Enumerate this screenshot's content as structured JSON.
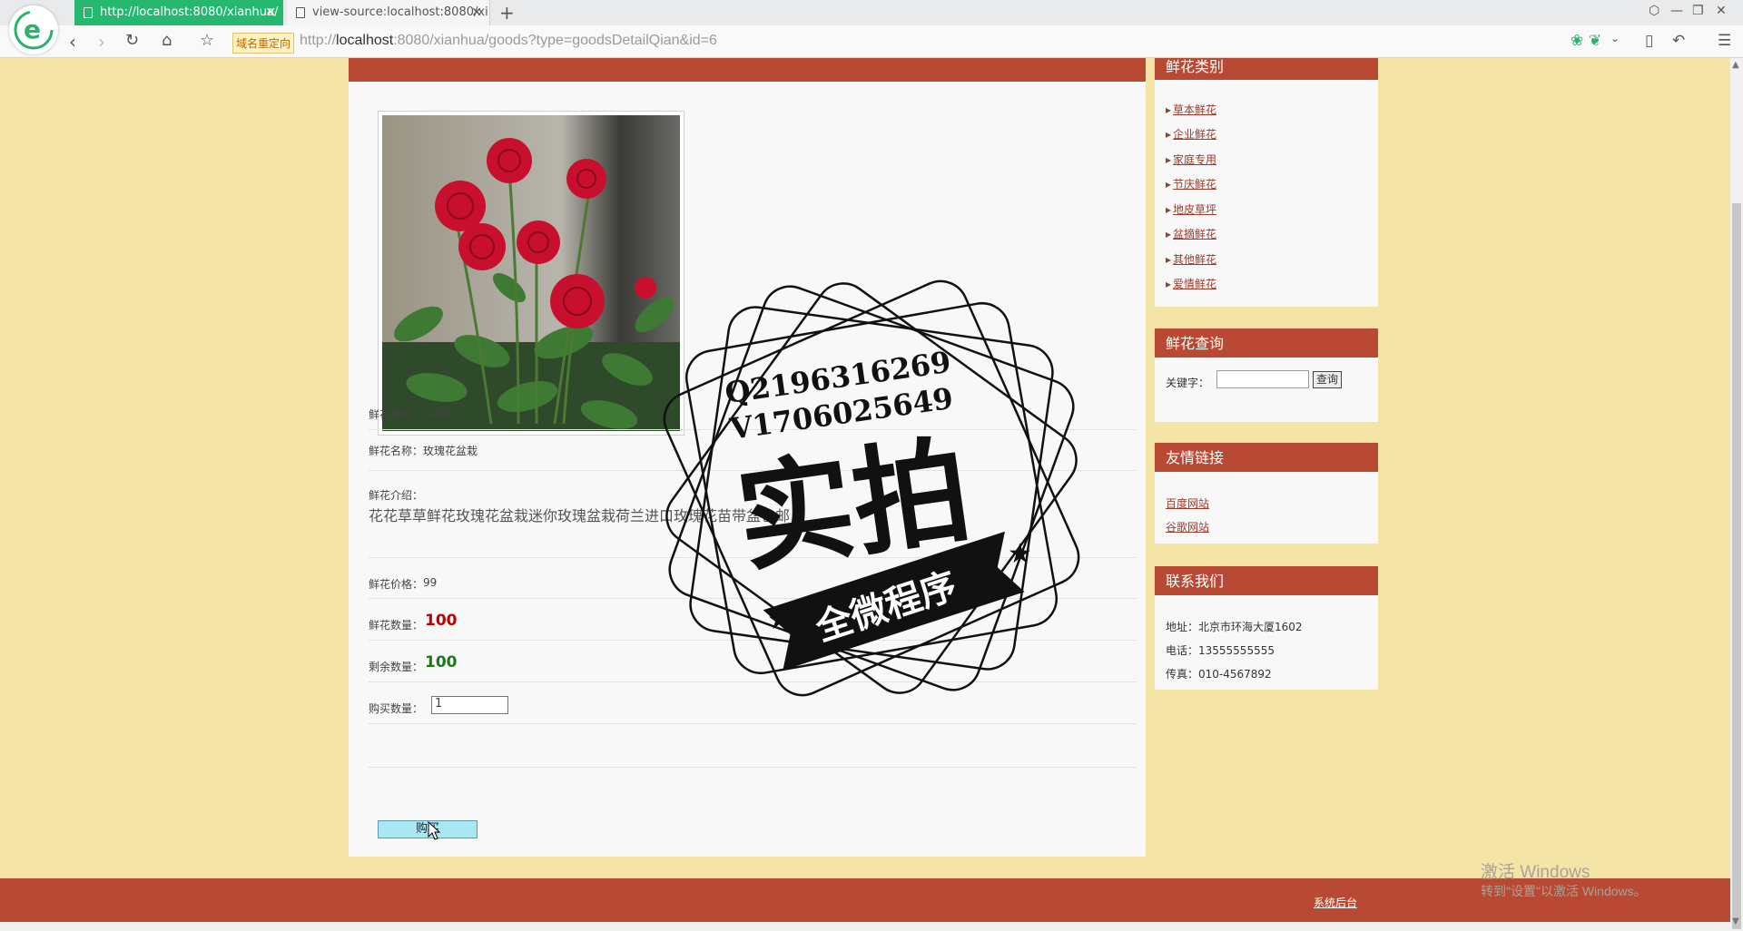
{
  "browser": {
    "tabs": [
      {
        "label": "http://localhost:8080/xianhua/"
      },
      {
        "label": "view-source:localhost:8080/xi"
      }
    ],
    "redirect_badge": "域名重定向",
    "url_prefix": "http://",
    "url_host": "localhost",
    "url_rest": ":8080/xianhua/goods?type=goodsDetailQian&id=6"
  },
  "product": {
    "number_label": "鲜花编号：",
    "number_value": "1006",
    "name_label": "鲜花名称：",
    "name_value": "玫瑰花盆栽",
    "intro_label": "鲜花介绍：",
    "intro_text": "花花草草鲜花玫瑰花盆栽迷你玫瑰盆栽荷兰进口玫瑰花苗带盆包邮",
    "price_label": "鲜花价格：",
    "price_value": "99",
    "quantity_label": "鲜花数量：",
    "quantity_value": "100",
    "remaining_label": "剩余数量：",
    "remaining_value": "100",
    "buy_qty_label": "购买数量：",
    "buy_qty_value": "1",
    "buy_button": "购买"
  },
  "sidebar": {
    "categories_title": "鲜花类别",
    "categories": [
      "草本鲜花",
      "企业鲜花",
      "家庭专用",
      "节庆鲜花",
      "地皮草坪",
      "盆摘鲜花",
      "其他鲜花",
      "爱情鲜花"
    ],
    "search_title": "鲜花查询",
    "keyword_label": "关键字：",
    "search_button": "查询",
    "links_title": "友情链接",
    "links": [
      "百度网站",
      "谷歌网站"
    ],
    "contact_title": "联系我们",
    "contact": [
      "地址：北京市环海大厦1602",
      "电话：13555555555",
      "传真：010-4567892"
    ]
  },
  "footer": {
    "link": "系统后台"
  },
  "watermark": {
    "line1": "Q2196316269",
    "line2": "V1706025649",
    "big": "实拍",
    "banner": "全微程序"
  },
  "windows_activation": {
    "title": "激活 Windows",
    "subtitle": "转到\"设置\"以激活 Windows。"
  }
}
